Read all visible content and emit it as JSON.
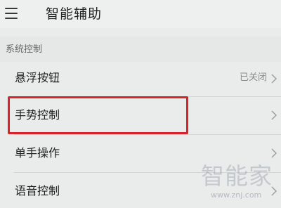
{
  "header": {
    "title": "智能辅助",
    "menu_icon": "hamburger-menu-icon"
  },
  "section": {
    "title": "系统控制"
  },
  "items": [
    {
      "label": "悬浮按钮",
      "value": "已关闭",
      "icon": "chevron-right-icon"
    },
    {
      "label": "手势控制",
      "value": "",
      "icon": "chevron-right-icon",
      "highlighted": true
    },
    {
      "label": "单手操作",
      "value": "",
      "icon": "chevron-right-icon"
    },
    {
      "label": "语音控制",
      "value": "",
      "icon": "chevron-right-icon"
    }
  ],
  "watermark": {
    "logo": "智能家",
    "url": "www.znj.com"
  },
  "colors": {
    "background": "#eaeceb",
    "highlight": "#d8232a",
    "text": "#222222",
    "secondary_text": "#8a8a8a"
  }
}
